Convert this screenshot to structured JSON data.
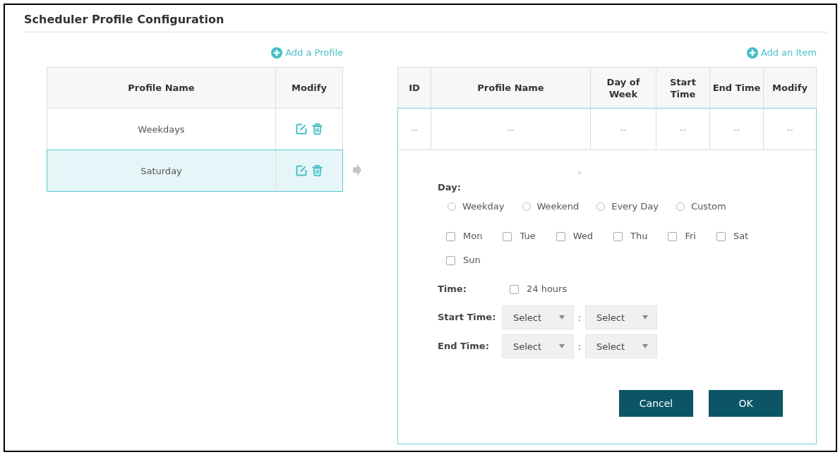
{
  "title": "Scheduler Profile Configuration",
  "profiles": {
    "add_link": "Add a Profile",
    "columns": [
      "Profile Name",
      "Modify"
    ],
    "rows": [
      {
        "name": "Weekdays",
        "selected": false
      },
      {
        "name": "Saturday",
        "selected": true
      }
    ]
  },
  "items": {
    "add_link": "Add an Item",
    "columns": [
      "ID",
      "Profile Name",
      "Day of Week",
      "Start Time",
      "End Time",
      "Modify"
    ],
    "rows": [
      [
        "--",
        "--",
        "--",
        "--",
        "--",
        "--"
      ]
    ]
  },
  "editor": {
    "day": {
      "label": "Day:",
      "modes": [
        {
          "label": "Weekday",
          "selected": false
        },
        {
          "label": "Weekend",
          "selected": false
        },
        {
          "label": "Every Day",
          "selected": false
        },
        {
          "label": "Custom",
          "selected": false
        }
      ],
      "days": [
        {
          "label": "Mon",
          "checked": false
        },
        {
          "label": "Tue",
          "checked": false
        },
        {
          "label": "Wed",
          "checked": false
        },
        {
          "label": "Thu",
          "checked": false
        },
        {
          "label": "Fri",
          "checked": false
        },
        {
          "label": "Sat",
          "checked": false
        },
        {
          "label": "Sun",
          "checked": false
        }
      ]
    },
    "time": {
      "label": "Time:",
      "all_day": {
        "label": "24 hours",
        "checked": false
      }
    },
    "ranges": [
      {
        "label": "Start Time:",
        "hour": "Select",
        "separator": ":",
        "minute": "Select"
      },
      {
        "label": "End Time:",
        "hour": "Select",
        "separator": ":",
        "minute": "Select"
      }
    ],
    "buttons": [
      "Cancel",
      "OK"
    ]
  }
}
